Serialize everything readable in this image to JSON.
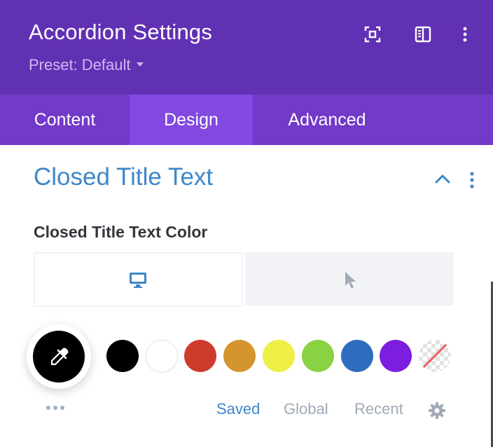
{
  "header": {
    "title": "Accordion Settings",
    "preset_label": "Preset: Default",
    "icons": [
      "focus-expand-icon",
      "sidebar-layout-icon",
      "more-vertical-icon"
    ]
  },
  "tabs": [
    {
      "label": "Content",
      "active": false
    },
    {
      "label": "Design",
      "active": true
    },
    {
      "label": "Advanced",
      "active": false
    }
  ],
  "section": {
    "title": "Closed Title Text",
    "icons": [
      "chevron-up-icon",
      "more-vertical-icon"
    ]
  },
  "field": {
    "label": "Closed Title Text Color",
    "device_tabs": [
      {
        "icon": "desktop-icon",
        "active": true
      },
      {
        "icon": "cursor-hover-icon",
        "active": false
      }
    ],
    "current_color": "#000000",
    "swatches": [
      "#000000",
      "#ffffff",
      "#cd3b2d",
      "#d5952e",
      "#eeee45",
      "#8ad143",
      "#2e6dbd",
      "#7d1de0",
      "transparent"
    ],
    "color_tabs": [
      "Saved",
      "Global",
      "Recent"
    ],
    "active_color_tab": "Saved"
  },
  "colors": {
    "header_bg": "#6131b4",
    "tabs_bg": "#7339c8",
    "active_tab_bg": "#8248df",
    "accent_blue": "#3e87c9"
  }
}
